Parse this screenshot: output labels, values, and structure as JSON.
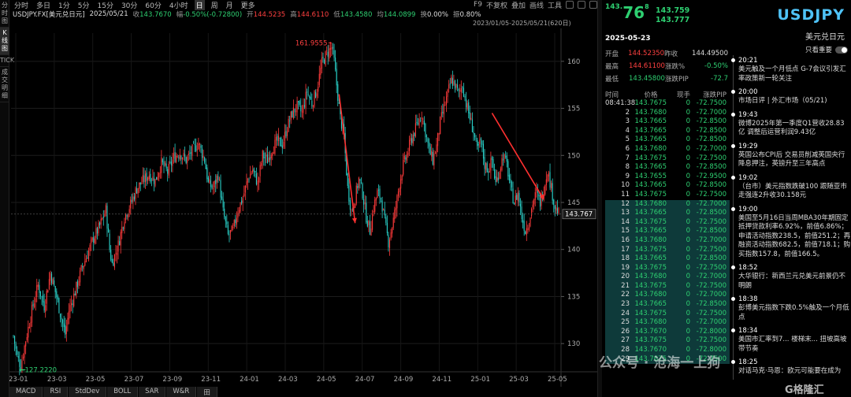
{
  "left_tabs": [
    "分时图",
    "K线图",
    "TICK",
    "成交明细"
  ],
  "toolbar": {
    "timeframes": [
      "分时",
      "多日",
      "1分",
      "5分",
      "15分",
      "30分",
      "60分",
      "4小时",
      "日",
      "周",
      "月",
      "更多"
    ],
    "active_timeframe": "日",
    "right": [
      "F9",
      "不复权",
      "叠加",
      "画线",
      "工具"
    ]
  },
  "infobar": {
    "symbol": "USDJPY.FX[美元兑日元]",
    "date": "2025/05/21",
    "close_label": "收",
    "close": "143.7670",
    "change_label": "幅",
    "change": "-0.50%(-0.72800)",
    "open_label": "开",
    "open": "144.5235",
    "high_label": "高",
    "high": "144.6110",
    "low_label": "低",
    "low": "143.4580",
    "avg_label": "均",
    "avg": "144.0899",
    "turnover_label": "换",
    "turnover": "0.00%",
    "amp_label": "振",
    "amp": "0.80%"
  },
  "range_text": "2023/01/05-2025/05/21(620日)",
  "chart_data": {
    "type": "candlestick",
    "x_tick_labels": [
      "23-01",
      "23-03",
      "23-05",
      "23-07",
      "23-09",
      "23-11",
      "24-01",
      "24-03",
      "24-05",
      "24-07",
      "24-09",
      "24-11",
      "25-01",
      "25-03",
      "25-05"
    ],
    "y_tick_labels": [
      "130",
      "135",
      "140",
      "145",
      "150",
      "155",
      "160"
    ],
    "ylim": [
      127,
      163
    ],
    "high_annotation": "161.9555",
    "low_annotation": "127.2220",
    "current_price_label": "143.767",
    "close_path": [
      [
        0,
        130.8
      ],
      [
        3,
        128.6
      ],
      [
        6,
        127.6
      ],
      [
        10,
        130.4
      ],
      [
        15,
        133.5
      ],
      [
        20,
        136.2
      ],
      [
        25,
        134.0
      ],
      [
        30,
        137.5
      ],
      [
        35,
        135.0
      ],
      [
        38,
        133.2
      ],
      [
        42,
        131.0
      ],
      [
        45,
        133.5
      ],
      [
        50,
        135.5
      ],
      [
        55,
        137.8
      ],
      [
        60,
        139.5
      ],
      [
        65,
        141.2
      ],
      [
        70,
        142.5
      ],
      [
        75,
        144.2
      ],
      [
        78,
        140.0
      ],
      [
        80,
        138.5
      ],
      [
        85,
        140.5
      ],
      [
        90,
        143.5
      ],
      [
        95,
        144.8
      ],
      [
        100,
        146.5
      ],
      [
        105,
        147.3
      ],
      [
        110,
        148.0
      ],
      [
        115,
        147.3
      ],
      [
        120,
        149.2
      ],
      [
        125,
        148.2
      ],
      [
        130,
        149.8
      ],
      [
        135,
        150.3
      ],
      [
        140,
        149.5
      ],
      [
        145,
        150.5
      ],
      [
        150,
        151.3
      ],
      [
        155,
        149.5
      ],
      [
        158,
        147.0
      ],
      [
        162,
        146.5
      ],
      [
        166,
        148.0
      ],
      [
        170,
        144.0
      ],
      [
        174,
        141.5
      ],
      [
        178,
        142.0
      ],
      [
        182,
        144.2
      ],
      [
        186,
        145.5
      ],
      [
        190,
        147.5
      ],
      [
        194,
        148.5
      ],
      [
        198,
        147.0
      ],
      [
        202,
        150.0
      ],
      [
        206,
        149.5
      ],
      [
        210,
        150.8
      ],
      [
        214,
        151.5
      ],
      [
        218,
        151.2
      ],
      [
        222,
        153.0
      ],
      [
        226,
        154.5
      ],
      [
        230,
        155.2
      ],
      [
        234,
        154.5
      ],
      [
        238,
        156.8
      ],
      [
        242,
        155.5
      ],
      [
        246,
        157.0
      ],
      [
        250,
        159.8
      ],
      [
        254,
        160.8
      ],
      [
        258,
        161.5
      ],
      [
        260,
        160.0
      ],
      [
        262,
        157.5
      ],
      [
        265,
        154.0
      ],
      [
        268,
        152.0
      ],
      [
        271,
        146.5
      ],
      [
        274,
        144.0
      ],
      [
        277,
        145.5
      ],
      [
        280,
        147.5
      ],
      [
        283,
        146.0
      ],
      [
        286,
        143.5
      ],
      [
        289,
        142.0
      ],
      [
        292,
        144.5
      ],
      [
        295,
        146.0
      ],
      [
        298,
        145.5
      ],
      [
        301,
        143.0
      ],
      [
        304,
        140.8
      ],
      [
        307,
        142.5
      ],
      [
        310,
        144.5
      ],
      [
        313,
        147.0
      ],
      [
        316,
        149.0
      ],
      [
        319,
        150.0
      ],
      [
        322,
        151.5
      ],
      [
        325,
        152.5
      ],
      [
        328,
        153.5
      ],
      [
        331,
        154.5
      ],
      [
        334,
        152.5
      ],
      [
        337,
        150.5
      ],
      [
        340,
        149.5
      ],
      [
        343,
        151.0
      ],
      [
        346,
        153.5
      ],
      [
        349,
        155.0
      ],
      [
        352,
        156.5
      ],
      [
        355,
        158.0
      ],
      [
        358,
        157.5
      ],
      [
        361,
        156.5
      ],
      [
        364,
        157.5
      ],
      [
        367,
        155.5
      ],
      [
        370,
        154.0
      ],
      [
        373,
        152.5
      ],
      [
        376,
        150.5
      ],
      [
        379,
        151.5
      ],
      [
        382,
        149.0
      ],
      [
        385,
        148.5
      ],
      [
        388,
        149.5
      ],
      [
        391,
        147.0
      ],
      [
        394,
        148.5
      ],
      [
        397,
        150.0
      ],
      [
        400,
        149.0
      ],
      [
        403,
        146.5
      ],
      [
        406,
        145.0
      ],
      [
        409,
        146.0
      ],
      [
        412,
        143.5
      ],
      [
        415,
        142.0
      ],
      [
        418,
        143.0
      ],
      [
        421,
        145.0
      ],
      [
        424,
        146.0
      ],
      [
        427,
        145.0
      ],
      [
        430,
        146.5
      ],
      [
        433,
        148.5
      ],
      [
        436,
        146.5
      ],
      [
        439,
        144.5
      ],
      [
        442,
        143.8
      ]
    ],
    "n_bars": 443
  },
  "bottom_tabs": [
    "MACD",
    "RSI",
    "StdDev",
    "BOLL",
    "SAR",
    "W&R",
    "田"
  ],
  "quote": {
    "price_a": "143.",
    "price_b": "76",
    "price_c": "8",
    "bid": "143.759",
    "ask": "143.777",
    "symbol": "USDJPY",
    "name": "美元兑日元",
    "date": "2025-05-23",
    "open_label": "开盘",
    "open": "144.52350",
    "prev_label": "昨收",
    "prev": "144.49500",
    "high_label": "最高",
    "high": "144.61100",
    "chg_label": "涨跌%",
    "chg": "-0.50%",
    "low_label": "最低",
    "low": "143.45800",
    "pip_label": "涨跌PIP",
    "pip": "-72.7"
  },
  "ticks": {
    "headers": [
      "时间",
      "价格",
      "现手",
      "涨跌PIP"
    ],
    "rows": [
      {
        "t": "08:41:38",
        "p": "143.7675",
        "q": "0",
        "d": "-72.7500"
      },
      {
        "t": "2",
        "p": "143.7680",
        "q": "0",
        "d": "-72.7000"
      },
      {
        "t": "3",
        "p": "143.7665",
        "q": "0",
        "d": "-72.8500"
      },
      {
        "t": "4",
        "p": "143.7665",
        "q": "0",
        "d": "-72.8500"
      },
      {
        "t": "5",
        "p": "143.7665",
        "q": "0",
        "d": "-72.8500"
      },
      {
        "t": "6",
        "p": "143.7680",
        "q": "0",
        "d": "-72.7000"
      },
      {
        "t": "7",
        "p": "143.7675",
        "q": "0",
        "d": "-72.7500"
      },
      {
        "t": "8",
        "p": "143.7665",
        "q": "0",
        "d": "-72.8500"
      },
      {
        "t": "9",
        "p": "143.7655",
        "q": "0",
        "d": "-72.9500"
      },
      {
        "t": "10",
        "p": "143.7665",
        "q": "0",
        "d": "-72.8500"
      },
      {
        "t": "11",
        "p": "143.7675",
        "q": "0",
        "d": "-72.7500"
      },
      {
        "t": "12",
        "p": "143.7680",
        "q": "0",
        "d": "-72.7000"
      },
      {
        "t": "13",
        "p": "143.7665",
        "q": "0",
        "d": "-72.8500"
      },
      {
        "t": "14",
        "p": "143.7675",
        "q": "0",
        "d": "-72.7500"
      },
      {
        "t": "15",
        "p": "143.7665",
        "q": "0",
        "d": "-72.8500"
      },
      {
        "t": "16",
        "p": "143.7680",
        "q": "0",
        "d": "-72.7000"
      },
      {
        "t": "17",
        "p": "143.7675",
        "q": "0",
        "d": "-72.7500"
      },
      {
        "t": "18",
        "p": "143.7665",
        "q": "0",
        "d": "-72.8500"
      },
      {
        "t": "19",
        "p": "143.7675",
        "q": "0",
        "d": "-72.7500"
      },
      {
        "t": "20",
        "p": "143.7680",
        "q": "0",
        "d": "-72.7000"
      },
      {
        "t": "21",
        "p": "143.7675",
        "q": "0",
        "d": "-72.7500"
      },
      {
        "t": "22",
        "p": "143.7680",
        "q": "0",
        "d": "-72.7000"
      },
      {
        "t": "23",
        "p": "143.7665",
        "q": "0",
        "d": "-72.8500"
      },
      {
        "t": "24",
        "p": "143.7675",
        "q": "0",
        "d": "-72.7500"
      },
      {
        "t": "25",
        "p": "143.7680",
        "q": "0",
        "d": "-72.7000"
      },
      {
        "t": "26",
        "p": "143.7670",
        "q": "0",
        "d": "-72.8000"
      },
      {
        "t": "27",
        "p": "143.7675",
        "q": "0",
        "d": "-72.7500"
      },
      {
        "t": "28",
        "p": "143.7670",
        "q": "0",
        "d": "-72.8000"
      },
      {
        "t": "29",
        "p": "143.7675",
        "q": "0",
        "d": "-72.7500"
      }
    ],
    "highlight_from": 11
  },
  "news": {
    "toggle_label": "只看重要",
    "items": [
      {
        "time": "20:21",
        "text": "美元触及一个月低点 G-7会议引发汇率政策新一轮关注"
      },
      {
        "time": "20:00",
        "text": "市场日评 | 外汇市场（05/21)"
      },
      {
        "time": "19:43",
        "text": "微博2025年第一季度Q1营收28.83亿 调整后运营利润9.43亿"
      },
      {
        "time": "19:29",
        "text": "英国公布CPI后 交易员削减英国央行降息押注，英镑升至三年高点"
      },
      {
        "time": "19:02",
        "text": "（台市）美元指数跌破100 跟随亚市走强连2升收30.158元"
      },
      {
        "time": "19:00",
        "text": "美国至5月16日当周MBA30年期固定抵押贷款利率6.92%，前值6.86%；申请活动指数238.5，前值251.2；再融资活动指数682.5，前值718.1；购买指数157.8，前值166.5。"
      },
      {
        "time": "18:52",
        "text": "大华银行：新西兰元兑美元前景仍不明朗"
      },
      {
        "time": "18:38",
        "text": "彭博美元指数下跌0.5%触及一个月低点"
      },
      {
        "time": "18:34",
        "text": "美国市汇率到7... 楼梯末... 扭坡高坡 带节奏"
      },
      {
        "time": "18:25",
        "text": "对话马克·马恩：欧元可能要在成为"
      }
    ]
  },
  "watermark": "公众号 · 沧海一上狗",
  "watermark2": "G格隆汇"
}
